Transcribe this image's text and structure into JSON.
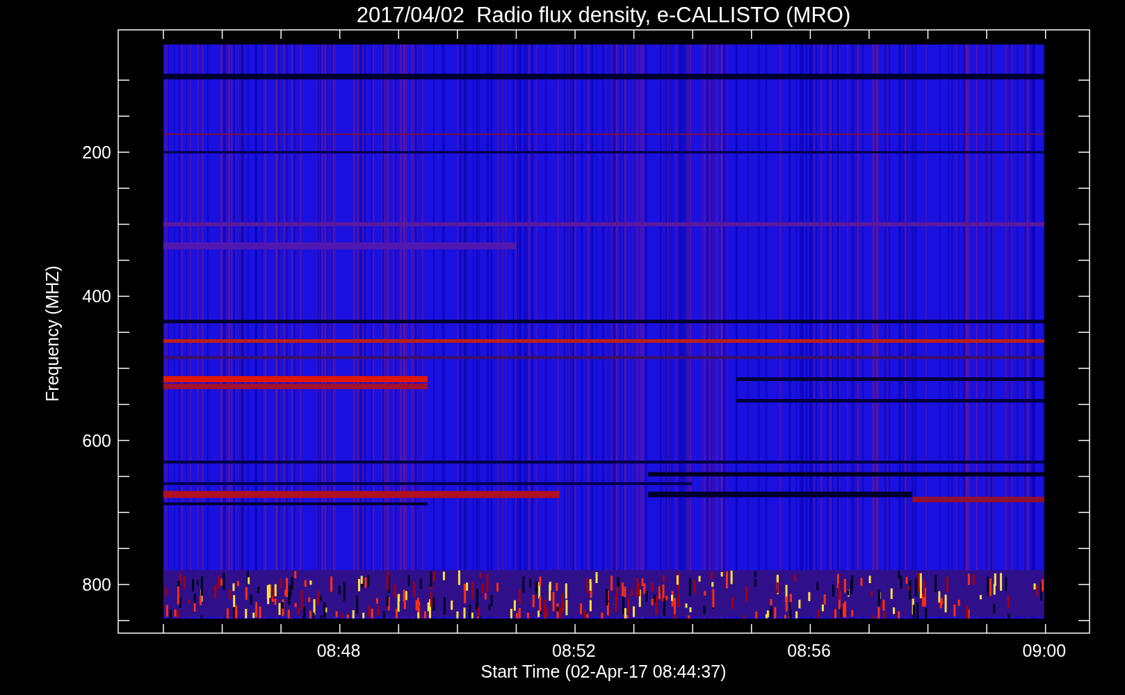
{
  "title": "2017/04/02  Radio flux density, e-CALLISTO (MRO)",
  "plot": {
    "ylabel": "Frequency (MHZ)",
    "xlabel": "Start Time (02-Apr-17 08:44:37)",
    "yticks": [
      "200",
      "400",
      "600",
      "800"
    ],
    "xticks": [
      "08:48",
      "08:52",
      "08:56",
      "09:00"
    ]
  }
}
